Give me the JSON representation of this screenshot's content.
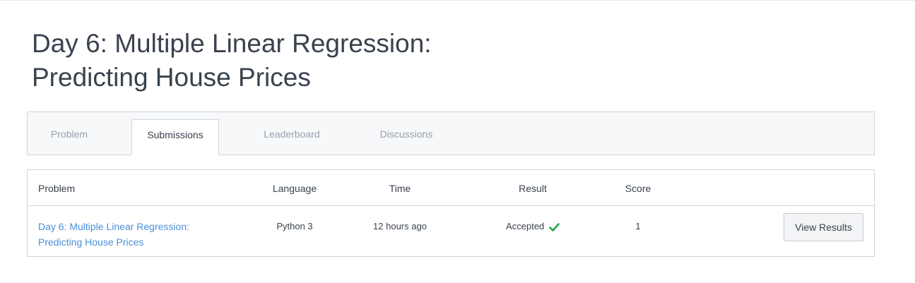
{
  "title": {
    "line1": "Day 6: Multiple Linear Regression:",
    "line2": "Predicting House Prices"
  },
  "tabs": [
    {
      "label": "Problem",
      "active": false
    },
    {
      "label": "Submissions",
      "active": true
    },
    {
      "label": "Leaderboard",
      "active": false
    },
    {
      "label": "Discussions",
      "active": false
    }
  ],
  "table": {
    "headers": {
      "problem": "Problem",
      "language": "Language",
      "time": "Time",
      "result": "Result",
      "score": "Score"
    },
    "rows": [
      {
        "problem_line1": "Day 6: Multiple Linear Regression:",
        "problem_line2": "Predicting House Prices",
        "language": "Python 3",
        "time": "12 hours ago",
        "result": "Accepted",
        "result_icon": "check-icon",
        "score": "1",
        "action_label": "View Results"
      }
    ]
  },
  "colors": {
    "link": "#4a90d9",
    "accepted": "#1ba94c",
    "text": "#39424e",
    "muted": "#979faf"
  }
}
